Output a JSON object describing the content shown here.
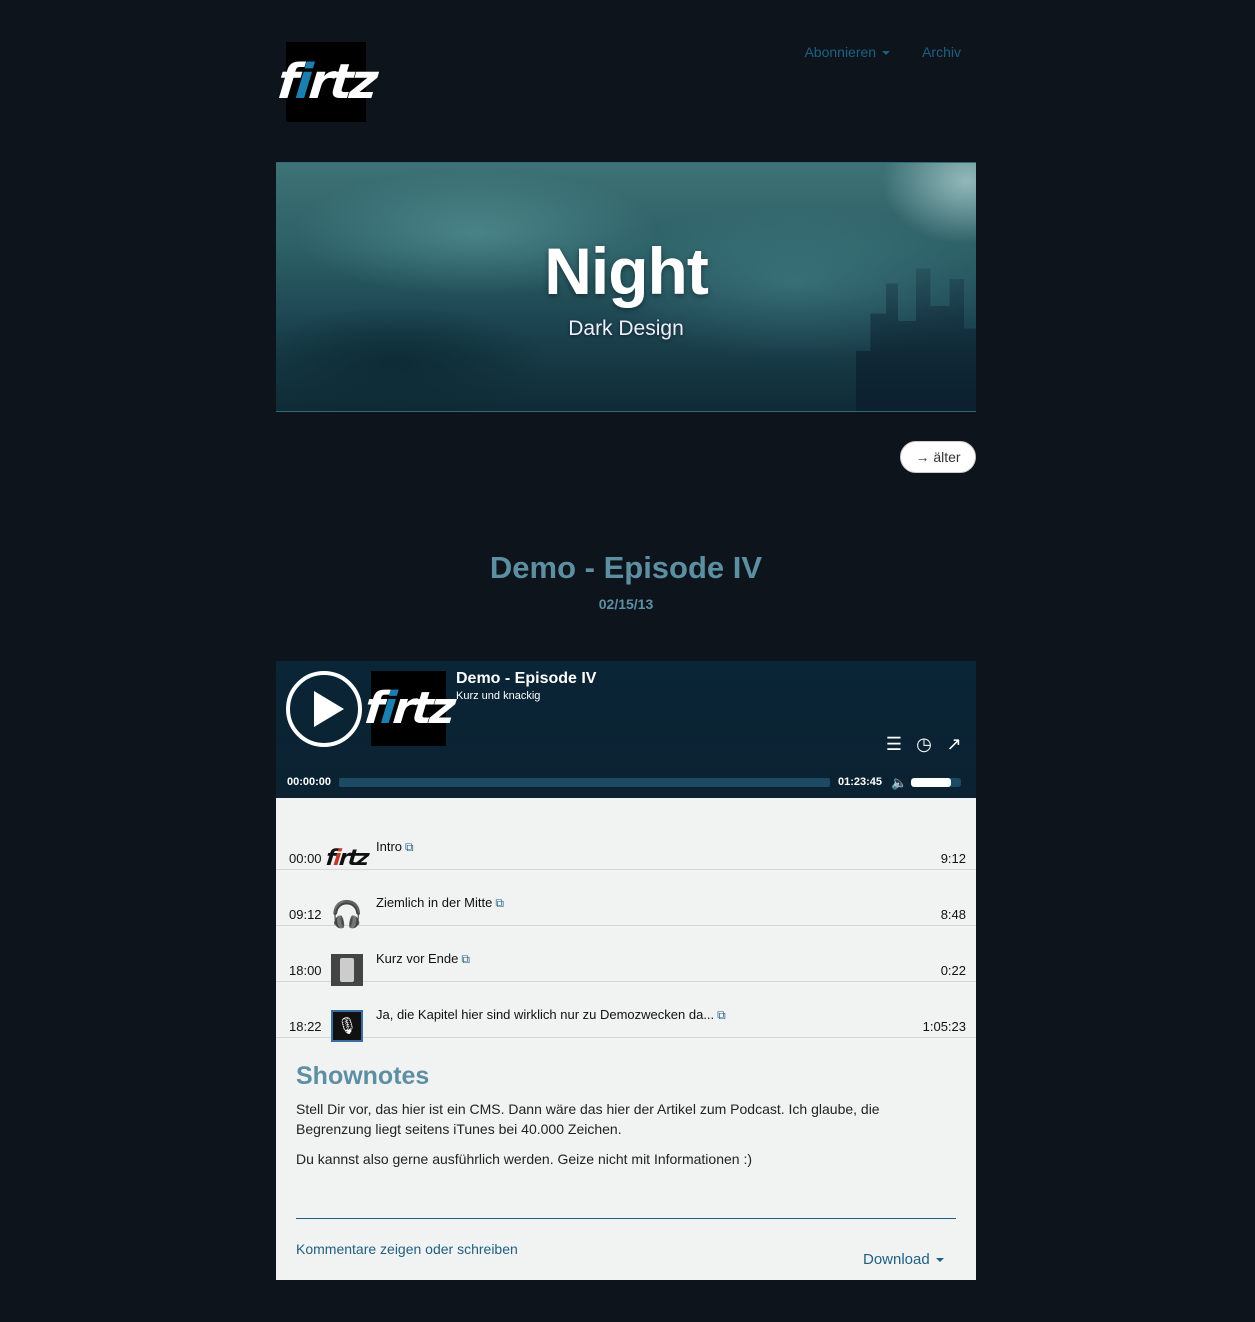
{
  "header": {
    "logo_text_a": "f",
    "logo_text_b": "i",
    "logo_text_c": "rtz",
    "nav": {
      "subscribe_label": "Abonnieren",
      "archive_label": "Archiv"
    }
  },
  "hero": {
    "title": "Night",
    "subtitle": "Dark Design"
  },
  "pagination": {
    "older_label": "→ älter"
  },
  "post": {
    "title": "Demo - Episode IV",
    "date": "02/15/13"
  },
  "player": {
    "episode_title": "Demo - Episode IV",
    "episode_subtitle": "Kurz und knackig",
    "current_time": "00:00:00",
    "total_time": "01:23:45",
    "progress": 0,
    "volume": 0.8,
    "icons": [
      "chapters-icon",
      "clock-icon",
      "share-icon",
      "speaker-icon"
    ]
  },
  "chapters": [
    {
      "start": "00:00",
      "title": "Intro",
      "duration": "9:12"
    },
    {
      "start": "09:12",
      "title": "Ziemlich in der Mitte",
      "duration": "8:48"
    },
    {
      "start": "18:00",
      "title": "Kurz vor Ende",
      "duration": "0:22"
    },
    {
      "start": "18:22",
      "title": "Ja, die Kapitel hier sind wirklich nur zu Demozwecken da...",
      "duration": "1:05:23"
    }
  ],
  "shownotes": {
    "title": "Shownotes",
    "paragraph1": "Stell Dir vor, das hier ist ein CMS. Dann wäre das hier der Artikel zum Podcast. Ich glaube, die Begrenzung liegt seitens iTunes bei 40.000 Zeichen.",
    "paragraph2": "Du kannst also gerne ausführlich werden. Geize nicht mit Informationen :)"
  },
  "footer": {
    "comments_label": "Kommentare zeigen oder schreiben",
    "download_label": "Download"
  },
  "colors": {
    "background": "#0d141c",
    "accent": "#5d8fa3",
    "link": "#1f5f82",
    "player_bg": "#0a2536",
    "panel_bg": "#f1f2f2"
  }
}
